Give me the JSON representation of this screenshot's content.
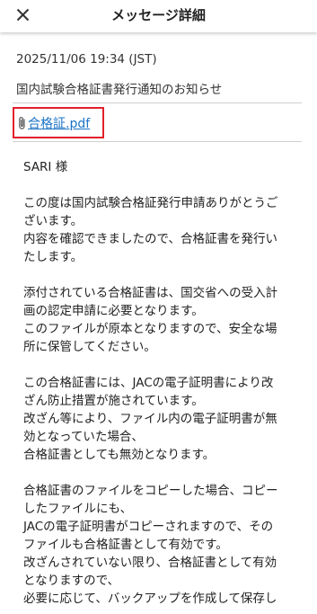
{
  "header": {
    "title": "メッセージ詳細",
    "close_icon": "close-icon"
  },
  "message": {
    "datetime": "2025/11/06 19:34 (JST)",
    "subject": "国内試験合格証書発行通知のお知らせ",
    "attachment": {
      "icon": "paperclip-icon",
      "filename": "合格証.pdf"
    },
    "body": {
      "recipient": "SARI 様",
      "p1_l1": "この度は国内試験合格証発行申請ありがとうご",
      "p1_l2": "ざいます。",
      "p1_l3": "内容を確認できましたので、合格証書を発行い",
      "p1_l4": "たします。",
      "p2_l1": "添付されている合格証書は、国交省への受入計",
      "p2_l2": "画の認定申請に必要となります。",
      "p2_l3": "このファイルが原本となりますので、安全な場",
      "p2_l4": "所に保管してください。",
      "p3_l1": "この合格証書には、JACの電子証明書により改",
      "p3_l2": "ざん防止措置が施されています。",
      "p3_l3": "改ざん等により、ファイル内の電子証明書が無",
      "p3_l4": "効となっていた場合、",
      "p3_l5": "合格証書としても無効となります。",
      "p4_l1": "合格証書のファイルをコピーした場合、コピー",
      "p4_l2": "したファイルにも、",
      "p4_l3": "JACの電子証明書がコピーされますので、その",
      "p4_l4": "ファイルも合格証書として有効です。",
      "p4_l5": "改ざんされていない限り、合格証書として有効",
      "p4_l6": "となりますので、",
      "p4_l7": "必要に応じて、バックアップを作成して保存し"
    }
  },
  "colors": {
    "link": "#1a73c7",
    "highlight_border": "#e2202a",
    "divider": "#cfcfcf"
  }
}
